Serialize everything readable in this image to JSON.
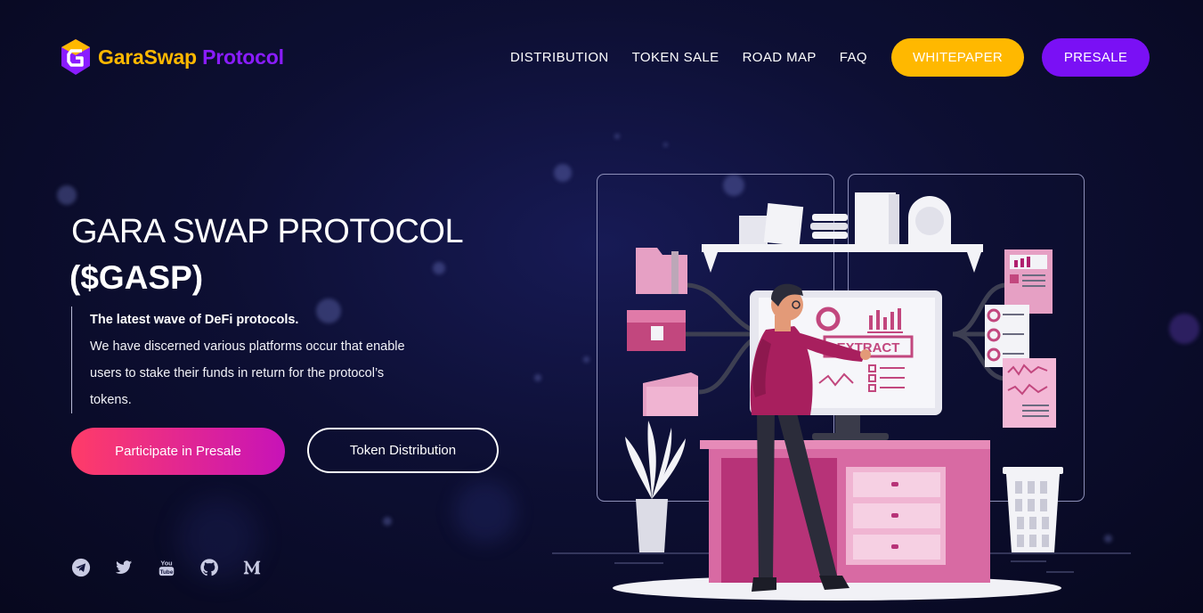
{
  "brand": {
    "name_part1": "GaraSwap",
    "name_part2": "Protocol",
    "logo_icon": "garaswap-logo-icon"
  },
  "nav": {
    "items": [
      {
        "label": "DISTRIBUTION"
      },
      {
        "label": "TOKEN SALE"
      },
      {
        "label": "ROAD MAP"
      },
      {
        "label": "FAQ"
      }
    ],
    "whitepaper_label": "WHITEPAPER",
    "presale_label": "PRESALE"
  },
  "hero": {
    "title": "GARA SWAP PROTOCOL",
    "ticker": "($GASP)",
    "tagline": "The latest wave of DeFi protocols.",
    "description": "We have discerned various platforms occur that enable users to stake their funds in return for the protocol’s tokens.",
    "participate_label": "Participate in Presale",
    "distribution_label": "Token Distribution"
  },
  "illustration": {
    "monitor_text": "EXTRACT"
  },
  "socials": [
    {
      "icon": "telegram-icon"
    },
    {
      "icon": "twitter-icon"
    },
    {
      "icon": "youtube-icon"
    },
    {
      "icon": "github-icon"
    },
    {
      "icon": "medium-icon"
    }
  ],
  "colors": {
    "accent_yellow": "#ffb800",
    "accent_purple": "#7a10f5",
    "gradient_start": "#ff3c68",
    "gradient_end": "#c713b8",
    "background": "#0d0f33"
  }
}
